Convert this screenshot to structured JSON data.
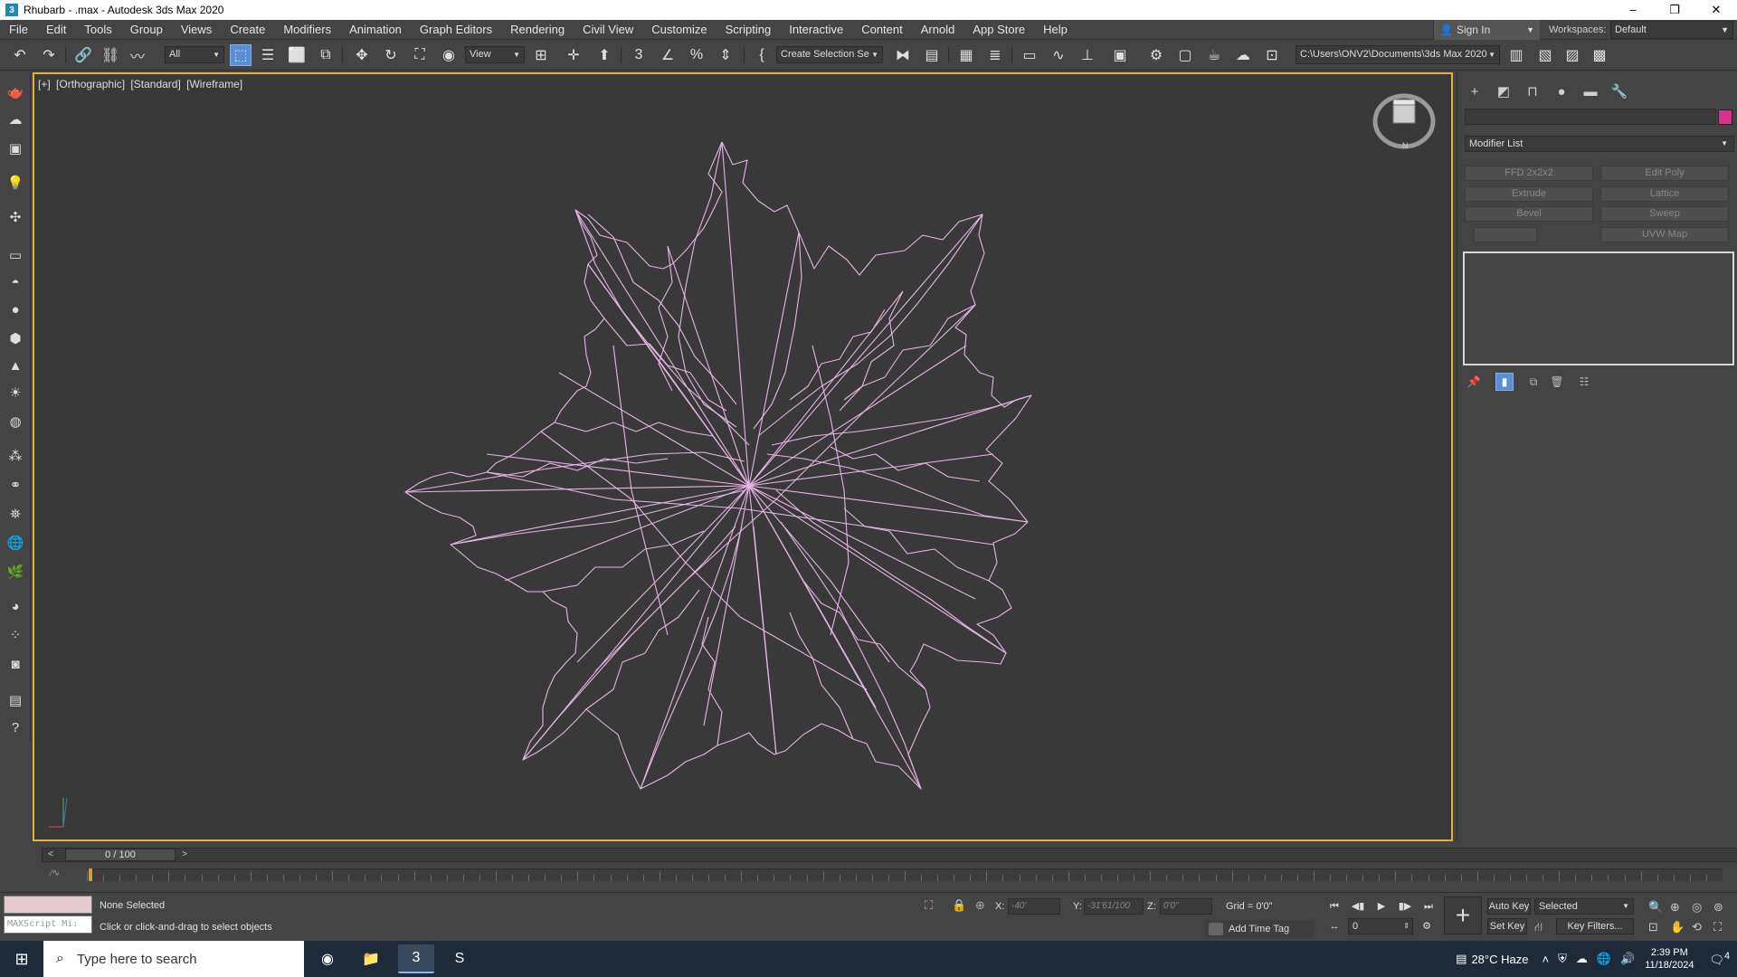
{
  "window": {
    "title": "Rhubarb - .max - Autodesk 3ds Max 2020",
    "controls": [
      "–",
      "❐",
      "✕"
    ]
  },
  "menu": {
    "items": [
      "File",
      "Edit",
      "Tools",
      "Group",
      "Views",
      "Create",
      "Modifiers",
      "Animation",
      "Graph Editors",
      "Rendering",
      "Civil View",
      "Customize",
      "Scripting",
      "Interactive",
      "Content",
      "Arnold",
      "App Store",
      "Help"
    ],
    "sign_in": "Sign In",
    "workspaces_label": "Workspaces:",
    "workspace": "Default"
  },
  "toolbar": {
    "selection_filter": "All",
    "ref_coord": "View",
    "named_selection": "Create Selection Se",
    "project_path": "C:\\Users\\ONV2\\Documents\\3ds Max 2020"
  },
  "viewport": {
    "label_parts": [
      "[+]",
      "[Orthographic]",
      "[Standard]",
      "[Wireframe]"
    ],
    "wire_color": "#e6b4e6",
    "border_color": "#e2b146",
    "viewcube_label": "N"
  },
  "command_panel": {
    "modifier_list": "Modifier List",
    "modifier_buttons": [
      "FFD 2x2x2",
      "Edit Poly",
      "Extrude",
      "Lattice",
      "Bevel",
      "Sweep",
      "",
      "UVW Map"
    ],
    "object_color": "#d4358a"
  },
  "time_slider": {
    "frame": "0 / 100",
    "prev": "<",
    "next": ">"
  },
  "status": {
    "selection": "None Selected",
    "prompt": "Click or click-and-drag to select objects",
    "maxscript": "MAXScript Mi:",
    "x_label": "X:",
    "x_value": "-40'",
    "y_label": "Y:",
    "y_value": "-31'61/100",
    "z_label": "Z:",
    "z_value": "0'0\"",
    "grid": "Grid = 0'0\"",
    "add_time_tag": "Add Time Tag",
    "current_frame": "0",
    "auto_key": "Auto Key",
    "set_key": "Set Key",
    "key_mode": "Selected",
    "key_filters": "Key Filters..."
  },
  "taskbar": {
    "search_placeholder": "Type here to search",
    "weather": "28°C  Haze",
    "time": "2:39 PM",
    "date": "11/18/2024",
    "notifications": "4"
  }
}
